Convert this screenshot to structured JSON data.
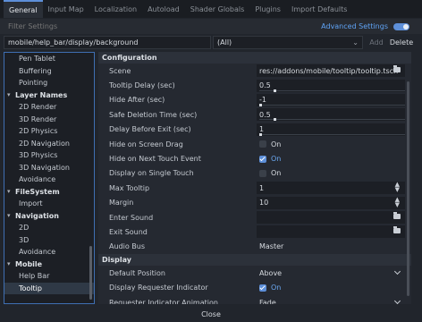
{
  "tabs": [
    "General",
    "Input Map",
    "Localization",
    "Autoload",
    "Shader Globals",
    "Plugins",
    "Import Defaults"
  ],
  "active_tab": 0,
  "filter": {
    "placeholder": "Filter Settings",
    "advanced_label": "Advanced Settings"
  },
  "path": {
    "value": "mobile/help_bar/display/background",
    "type": "(All)",
    "add_label": "Add",
    "delete_label": "Delete"
  },
  "sidebar": [
    {
      "kind": "item",
      "label": "Pen Tablet"
    },
    {
      "kind": "item",
      "label": "Buffering"
    },
    {
      "kind": "item",
      "label": "Pointing"
    },
    {
      "kind": "head",
      "label": "Layer Names"
    },
    {
      "kind": "item",
      "label": "2D Render"
    },
    {
      "kind": "item",
      "label": "3D Render"
    },
    {
      "kind": "item",
      "label": "2D Physics"
    },
    {
      "kind": "item",
      "label": "2D Navigation"
    },
    {
      "kind": "item",
      "label": "3D Physics"
    },
    {
      "kind": "item",
      "label": "3D Navigation"
    },
    {
      "kind": "item",
      "label": "Avoidance"
    },
    {
      "kind": "head",
      "label": "FileSystem"
    },
    {
      "kind": "item",
      "label": "Import"
    },
    {
      "kind": "head",
      "label": "Navigation"
    },
    {
      "kind": "item",
      "label": "2D"
    },
    {
      "kind": "item",
      "label": "3D"
    },
    {
      "kind": "item",
      "label": "Avoidance"
    },
    {
      "kind": "head",
      "label": "Mobile"
    },
    {
      "kind": "item",
      "label": "Help Bar"
    },
    {
      "kind": "item",
      "label": "Tooltip",
      "selected": true
    }
  ],
  "main": {
    "sections": [
      {
        "title": "Configuration",
        "rows": [
          {
            "label": "Scene",
            "value": "res://addons/mobile/tooltip/tooltip.tscn",
            "kind": "file"
          },
          {
            "label": "Tooltip Delay (sec)",
            "value": "0.5",
            "kind": "slider",
            "level": 0.1
          },
          {
            "label": "Hide After (sec)",
            "value": "-1",
            "kind": "slider",
            "level": 0.0
          },
          {
            "label": "Safe Deletion Time (sec)",
            "value": "0.5",
            "kind": "slider",
            "level": 0.1
          },
          {
            "label": "Delay Before Exit (sec)",
            "value": "1",
            "kind": "slider",
            "level": 0.0
          },
          {
            "label": "Hide on Screen Drag",
            "value": "On",
            "kind": "check",
            "checked": false
          },
          {
            "label": "Hide on Next Touch Event",
            "value": "On",
            "kind": "check",
            "checked": true
          },
          {
            "label": "Display on Single Touch",
            "value": "On",
            "kind": "check",
            "checked": false
          },
          {
            "label": "Max Tooltip",
            "value": "1",
            "kind": "spin"
          },
          {
            "label": "Margin",
            "value": "10",
            "kind": "spin"
          },
          {
            "label": "Enter Sound",
            "value": "",
            "kind": "file"
          },
          {
            "label": "Exit Sound",
            "value": "",
            "kind": "file"
          },
          {
            "label": "Audio Bus",
            "value": "Master",
            "kind": "text"
          }
        ]
      },
      {
        "title": "Display",
        "rows": [
          {
            "label": "Default Position",
            "value": "Above",
            "kind": "select"
          },
          {
            "label": "Display Requester Indicator",
            "value": "On",
            "kind": "check",
            "checked": true
          },
          {
            "label": "Requester Indicator Animation",
            "value": "Fade",
            "kind": "select"
          }
        ]
      }
    ]
  },
  "footer": {
    "close_label": "Close"
  }
}
